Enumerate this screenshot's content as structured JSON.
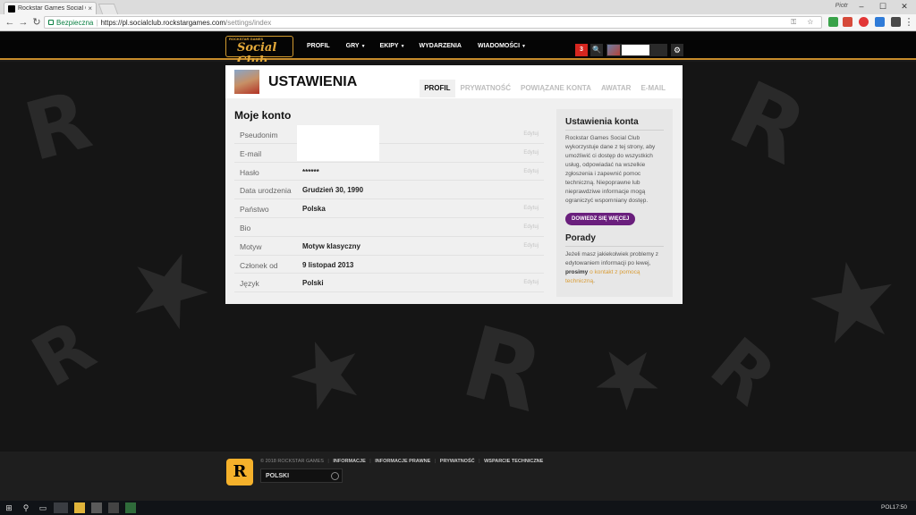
{
  "browser": {
    "tab_title": "Rockstar Games Social C",
    "tab_close": "×",
    "user_label": "Piotr",
    "min": "–",
    "max": "☐",
    "close": "✕",
    "back": "←",
    "forward": "→",
    "reload": "↻",
    "secure_label": "Bezpieczna",
    "url_host": "https://pl.socialclub.rockstargames.com",
    "url_path": "/settings/index",
    "omni_icons": "⚿ ☆",
    "menu": "⋮"
  },
  "header": {
    "logo_small": "ROCKSTAR GAMES",
    "logo_main": "Social Club",
    "nav": [
      {
        "label": "PROFIL",
        "caret": ""
      },
      {
        "label": "GRY",
        "caret": "▼"
      },
      {
        "label": "EKIPY",
        "caret": "▼"
      },
      {
        "label": "WYDARZENIA",
        "caret": ""
      },
      {
        "label": "WIADOMOŚCI",
        "caret": "▼"
      }
    ],
    "notification_count": "3",
    "search_icon": "🔍",
    "gear_icon": "⚙"
  },
  "page": {
    "title": "USTAWIENIA",
    "tabs": [
      "PROFIL",
      "PRYWATNOŚĆ",
      "POWIĄZANE KONTA",
      "AWATAR",
      "E-MAIL"
    ],
    "section_title": "Moje konto",
    "rows": [
      {
        "label": "Pseudonim",
        "value": "",
        "edit": "Edytuj"
      },
      {
        "label": "E-mail",
        "value": "",
        "edit": "Edytuj"
      },
      {
        "label": "Hasło",
        "value": "******",
        "edit": "Edytuj"
      },
      {
        "label": "Data urodzenia",
        "value": "Grudzień 30, 1990",
        "edit": ""
      },
      {
        "label": "Państwo",
        "value": "Polska",
        "edit": "Edytuj"
      },
      {
        "label": "Bio",
        "value": "",
        "edit": "Edytuj"
      },
      {
        "label": "Motyw",
        "value": "Motyw klasyczny",
        "edit": "Edytuj"
      },
      {
        "label": "Członek od",
        "value": "9 listopad 2013",
        "edit": ""
      },
      {
        "label": "Język",
        "value": "Polski",
        "edit": "Edytuj"
      }
    ]
  },
  "sidebar": {
    "title1": "Ustawienia konta",
    "text1": "Rockstar Games Social Club wykorzystuje dane z tej strony, aby umożliwić ci dostęp do wszystkich usług, odpowiadać na wszelkie zgłoszenia i zapewnić pomoc techniczną. Niepoprawne lub nieprawdziwe informacje mogą ograniczyć wspomniany dostęp.",
    "learn_more": "DOWIEDZ SIĘ WIĘCEJ",
    "title2": "Porady",
    "text2_a": "Jeżeli masz jakiekolwiek problemy z edytowaniem informacji po lewej,",
    "text2_bold": "prosimy",
    "text2_link": "o kontakt z pomocą techniczną",
    "text2_end": "."
  },
  "footer": {
    "r_logo": "R",
    "copyright": "© 2018 ROCKSTAR GAMES",
    "links": [
      "INFORMACJE",
      "INFORMACJE PRAWNE",
      "PRYWATNOŚĆ",
      "WSPARCIE TECHNICZNE"
    ],
    "language": "POLSKI"
  },
  "taskbar": {
    "start": "⊞",
    "search": "⚲",
    "taskview": "▭",
    "lang": "POL",
    "time": "17:50"
  },
  "colors": {
    "accent_gold": "#c78c2b",
    "notification_red": "#d5261f",
    "learn_more_purple": "#6a1f7d",
    "link_orange": "#d89c36"
  }
}
